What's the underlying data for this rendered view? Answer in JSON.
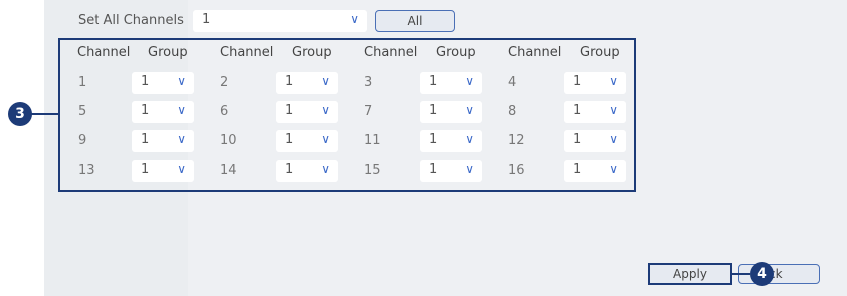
{
  "set_all": {
    "label": "Set All Channels",
    "value": "1",
    "chevron": "∨",
    "button_label": "All"
  },
  "grid": {
    "headers": [
      "Channel",
      "Group",
      "Channel",
      "Group",
      "Channel",
      "Group",
      "Channel",
      "Group"
    ],
    "rows": [
      [
        {
          "channel": "1",
          "group": "1"
        },
        {
          "channel": "2",
          "group": "1"
        },
        {
          "channel": "3",
          "group": "1"
        },
        {
          "channel": "4",
          "group": "1"
        }
      ],
      [
        {
          "channel": "5",
          "group": "1"
        },
        {
          "channel": "6",
          "group": "1"
        },
        {
          "channel": "7",
          "group": "1"
        },
        {
          "channel": "8",
          "group": "1"
        }
      ],
      [
        {
          "channel": "9",
          "group": "1"
        },
        {
          "channel": "10",
          "group": "1"
        },
        {
          "channel": "11",
          "group": "1"
        },
        {
          "channel": "12",
          "group": "1"
        }
      ],
      [
        {
          "channel": "13",
          "group": "1"
        },
        {
          "channel": "14",
          "group": "1"
        },
        {
          "channel": "15",
          "group": "1"
        },
        {
          "channel": "16",
          "group": "1"
        }
      ]
    ]
  },
  "callouts": {
    "grid": "3",
    "apply": "4"
  },
  "footer": {
    "apply_label": "Apply",
    "back_label": "ck"
  },
  "colors": {
    "accent": "#1d3b78",
    "chevron": "#3a68c8",
    "panel_bg": "#eef0f3"
  }
}
